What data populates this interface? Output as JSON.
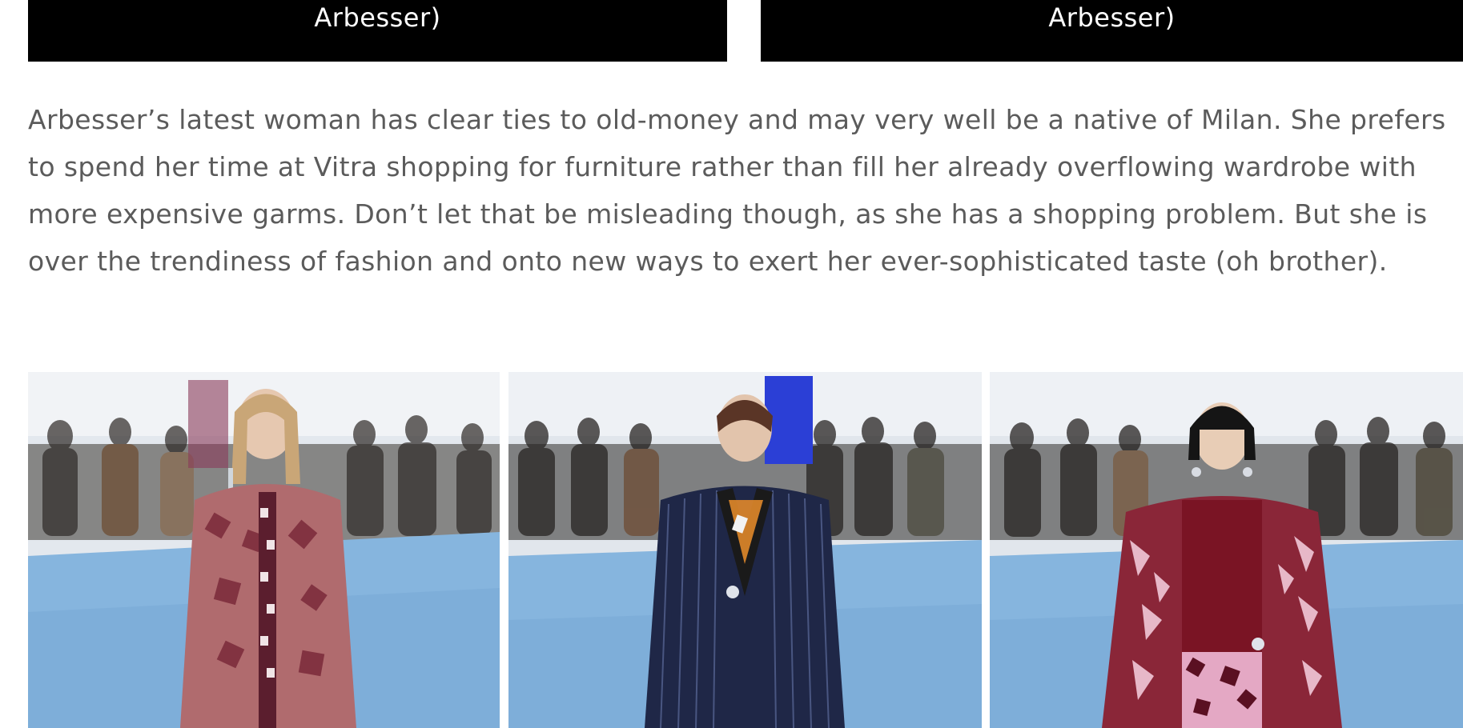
{
  "captions": {
    "left": "Arbesser)",
    "right": "Arbesser)"
  },
  "article": {
    "paragraph": "Arbesser’s latest woman has clear ties to old-money and may very well be a native of Milan. She prefers to spend her time at Vitra shopping for furniture rather than fill her already overflowing wardrobe with more expensive garms. Don’t let that be misleading though, as she has a shopping problem. But she is over the trendiness of fashion and onto new ways to exert her ever-sophisticated taste (oh brother)."
  },
  "colors": {
    "caption_bg": "#000000",
    "caption_text": "#ffffff",
    "body_text": "#5b5b5b",
    "runway_floor": "#7fb0dc",
    "backdrop": "#dfe5ec"
  }
}
